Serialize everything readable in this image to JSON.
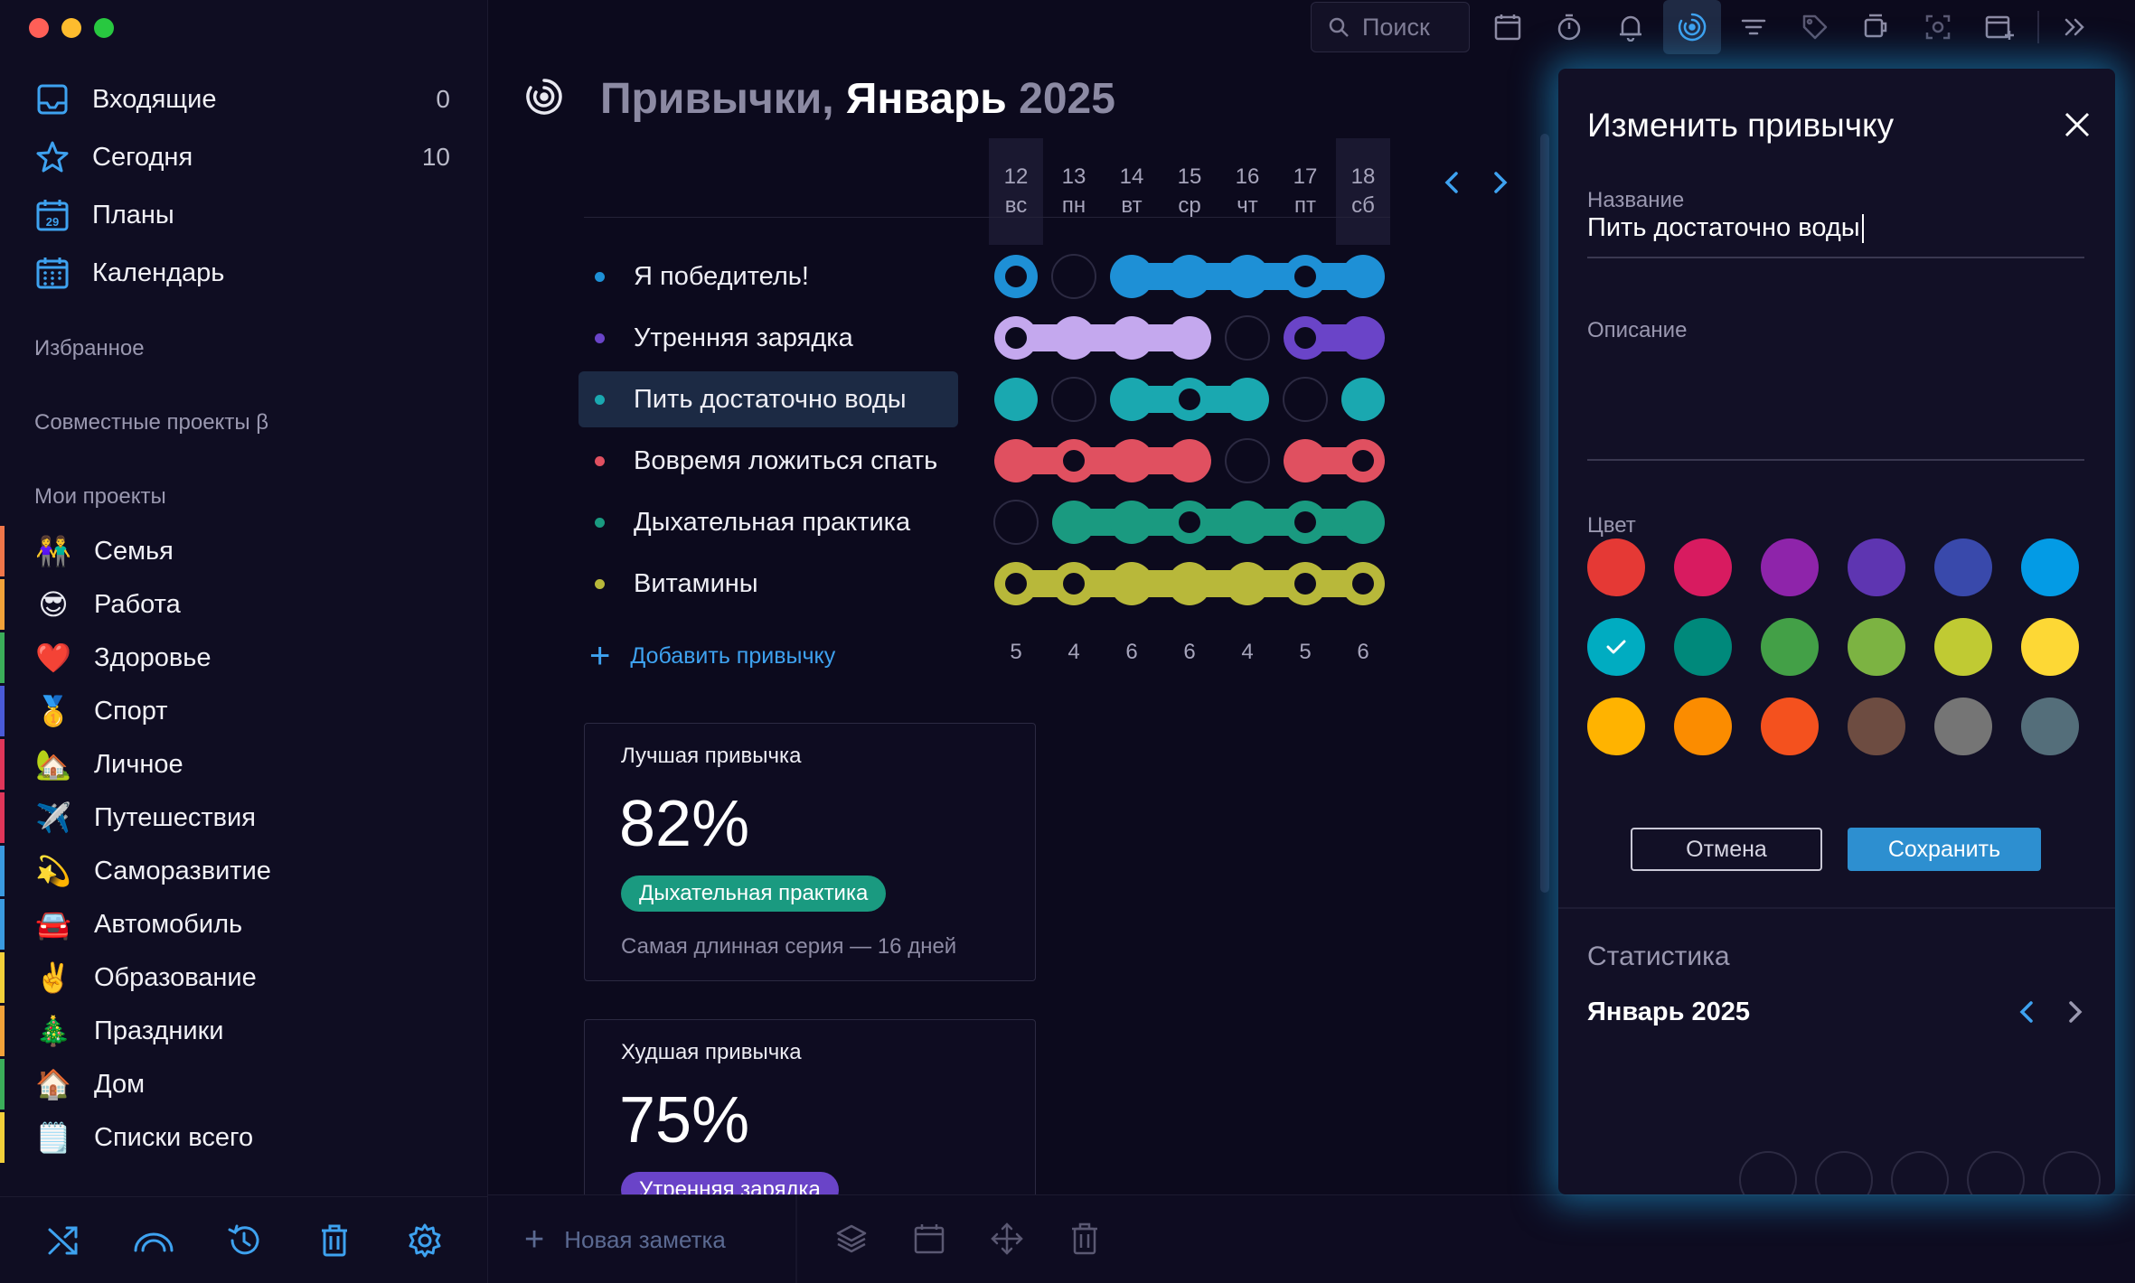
{
  "sidebar": {
    "nav": [
      {
        "label": "Входящие",
        "count": "0",
        "icon": "inbox-icon"
      },
      {
        "label": "Сегодня",
        "count": "10",
        "icon": "star-icon"
      },
      {
        "label": "Планы",
        "count": "",
        "icon": "calendar-day-icon",
        "badge": "29"
      },
      {
        "label": "Календарь",
        "count": "",
        "icon": "calendar-grid-icon"
      }
    ],
    "favorites_title": "Избранное",
    "shared_title": "Совместные проекты β",
    "projects_title": "Мои проекты",
    "projects": [
      {
        "label": "Семья",
        "emoji": "👫",
        "color": "#f0764a"
      },
      {
        "label": "Работа",
        "emoji": "😎",
        "color": "#f2a23a"
      },
      {
        "label": "Здоровье",
        "emoji": "❤️",
        "color": "#3bae5a"
      },
      {
        "label": "Спорт",
        "emoji": "🥇",
        "color": "#4a5ad8"
      },
      {
        "label": "Личное",
        "emoji": "🏡",
        "color": "#e0365a"
      },
      {
        "label": "Путешествия",
        "emoji": "✈️",
        "color": "#e0365a"
      },
      {
        "label": "Саморазвитие",
        "emoji": "💫",
        "color": "#3a9ae0"
      },
      {
        "label": "Автомобиль",
        "emoji": "🚘",
        "color": "#3a9ae0"
      },
      {
        "label": "Образование",
        "emoji": "✌️",
        "color": "#f2cf3a"
      },
      {
        "label": "Праздники",
        "emoji": "🎄",
        "color": "#f2a23a"
      },
      {
        "label": "Дом",
        "emoji": "🏠",
        "color": "#3bae5a"
      },
      {
        "label": "Списки всего",
        "emoji": "🗒️",
        "color": "#f2cf3a"
      }
    ],
    "bottom_icons": [
      "shuffle-icon",
      "rainbow-icon",
      "history-icon",
      "trash-icon",
      "settings-icon"
    ]
  },
  "toolbar": {
    "search_placeholder": "Поиск",
    "icons": [
      "calendar-icon",
      "timer-icon",
      "bell-icon",
      "habits-icon",
      "filter-icon",
      "tag-icon",
      "coffee-icon",
      "screenshot-icon",
      "add-window-icon",
      "collapse-panel-icon"
    ],
    "active": "habits-icon"
  },
  "main": {
    "title_part1": "Привычки,",
    "title_part2": "Январь",
    "title_part3": "2025",
    "days": [
      {
        "num": "12",
        "dow": "вс",
        "weekend": true
      },
      {
        "num": "13",
        "dow": "пн",
        "weekend": false
      },
      {
        "num": "14",
        "dow": "вт",
        "weekend": false
      },
      {
        "num": "15",
        "dow": "ср",
        "weekend": false
      },
      {
        "num": "16",
        "dow": "чт",
        "weekend": false
      },
      {
        "num": "17",
        "dow": "пт",
        "weekend": false
      },
      {
        "num": "18",
        "dow": "сб",
        "weekend": true
      }
    ],
    "habits": [
      {
        "label": "Я победитель!",
        "color": "#1e90d6",
        "done": [
          1,
          0,
          1,
          1,
          1,
          1,
          1
        ],
        "today_marker": [
          1,
          0,
          0,
          0,
          0,
          1,
          0
        ],
        "selected": false
      },
      {
        "label": "Утренняя зарядка",
        "color": "#c4a8ee",
        "color2": "#6a44c8",
        "done": [
          1,
          1,
          1,
          1,
          0,
          1,
          1
        ],
        "today_marker": [
          1,
          0,
          0,
          0,
          0,
          1,
          0
        ],
        "selected": false
      },
      {
        "label": "Пить достаточно воды",
        "color": "#1aa8b0",
        "done": [
          1,
          0,
          1,
          1,
          1,
          0,
          1
        ],
        "today_marker": [
          0,
          0,
          0,
          1,
          0,
          0,
          0
        ],
        "selected": true
      },
      {
        "label": "Вовремя ложиться спать",
        "color": "#e05060",
        "done": [
          1,
          1,
          1,
          1,
          0,
          1,
          1
        ],
        "today_marker": [
          0,
          1,
          0,
          0,
          0,
          0,
          1
        ],
        "selected": false
      },
      {
        "label": "Дыхательная практика",
        "color": "#1a9a80",
        "done": [
          0,
          1,
          1,
          1,
          1,
          1,
          1
        ],
        "today_marker": [
          0,
          0,
          0,
          1,
          0,
          1,
          0
        ],
        "selected": false
      },
      {
        "label": "Витамины",
        "color": "#b8b83a",
        "done": [
          1,
          1,
          1,
          1,
          1,
          1,
          1
        ],
        "today_marker": [
          1,
          1,
          0,
          0,
          0,
          1,
          1
        ],
        "selected": false
      }
    ],
    "counts": [
      "5",
      "4",
      "6",
      "6",
      "4",
      "5",
      "6"
    ],
    "add_habit": "Добавить привычку",
    "best": {
      "title": "Лучшая привычка",
      "value": "82%",
      "tag": "Дыхательная практика",
      "tag_color": "#1a9a80",
      "streak": "Самая длинная серия — 16 дней"
    },
    "worst": {
      "title": "Худшая привычка",
      "value": "75%",
      "tag": "Утренняя зарядка",
      "tag_color": "#6a44c8"
    }
  },
  "bottom": {
    "new_note": "Новая заметка",
    "icons": [
      "layers-icon",
      "calendar-icon",
      "move-icon",
      "trash-icon"
    ]
  },
  "edit_panel": {
    "title": "Изменить привычку",
    "name_label": "Название",
    "name_value": "Пить достаточно воды",
    "description_label": "Описание",
    "color_label": "Цвет",
    "colors": [
      "#e53935",
      "#d81b60",
      "#8e24aa",
      "#5e35b1",
      "#3949ab",
      "#039be5",
      "#00acc1",
      "#00897b",
      "#43a047",
      "#7cb342",
      "#c0ca33",
      "#fdd835",
      "#ffb300",
      "#fb8c00",
      "#f4511e",
      "#6d4c41",
      "#757575",
      "#546e7a"
    ],
    "selected_color_index": 6,
    "cancel": "Отмена",
    "save": "Сохранить",
    "stats_title": "Статистика",
    "stats_month": "Январь 2025"
  }
}
